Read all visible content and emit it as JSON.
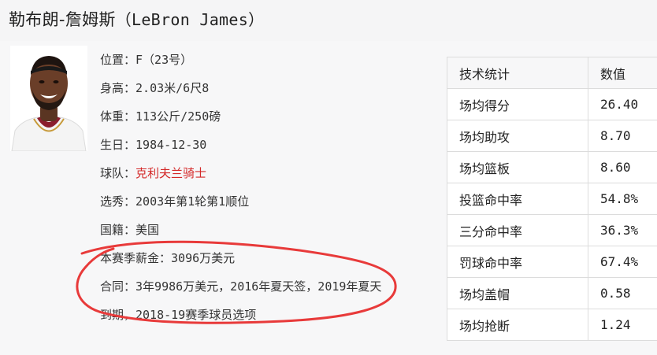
{
  "player": {
    "name_cn": "勒布朗-詹姆斯",
    "name_en": "（LeBron James）"
  },
  "info": {
    "position_label": "位置：",
    "position_value": "F（23号）",
    "height_label": "身高：",
    "height_value": "2.03米/6尺8",
    "weight_label": "体重：",
    "weight_value": "113公斤/250磅",
    "birthday_label": "生日：",
    "birthday_value": "1984-12-30",
    "team_label": "球队：",
    "team_value": "克利夫兰骑士",
    "draft_label": "选秀：",
    "draft_value": "2003年第1轮第1顺位",
    "nationality_label": "国籍：",
    "nationality_value": "美国",
    "salary_label": "本赛季薪金：",
    "salary_value": "3096万美元",
    "contract_label": "合同：",
    "contract_value": "3年9986万美元，2016年夏天签，2019年夏天到期，2018-19赛季球员选项"
  },
  "stats": {
    "header_stat": "技术统计",
    "header_value": "数值",
    "rows": [
      {
        "label": "场均得分",
        "value": "26.40"
      },
      {
        "label": "场均助攻",
        "value": "8.70"
      },
      {
        "label": "场均篮板",
        "value": "8.60"
      },
      {
        "label": "投篮命中率",
        "value": "54.8%"
      },
      {
        "label": "三分命中率",
        "value": "36.3%"
      },
      {
        "label": "罚球命中率",
        "value": "67.4%"
      },
      {
        "label": "场均盖帽",
        "value": "0.58"
      },
      {
        "label": "场均抢断",
        "value": "1.24"
      }
    ]
  },
  "colors": {
    "team_link": "#d42a2a",
    "annotation": "#e83a3a",
    "jersey": "#8b1e2e"
  }
}
